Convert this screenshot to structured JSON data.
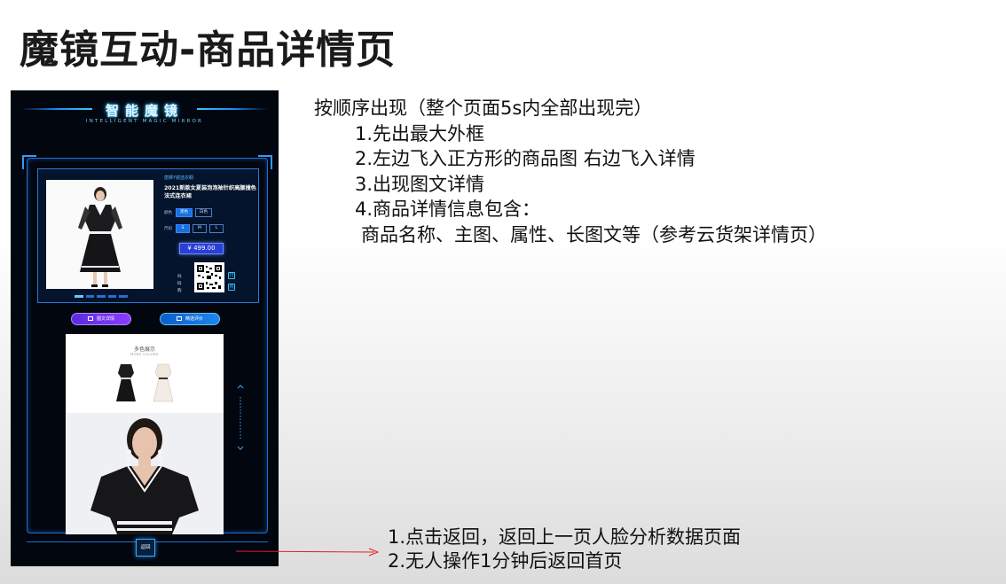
{
  "slide": {
    "title": "魔镜互动-商品详情页"
  },
  "mirror": {
    "brand": "智能魔镜",
    "brand_sub": "INTELLIGENT MAGIC MIRROR",
    "product": {
      "shop": "唐狮Y镜选衣橱",
      "name": "2021新款女夏装泡泡袖针织高腰撞色法式连衣裙",
      "color_label": "颜色",
      "colors": [
        "黑色",
        "白色"
      ],
      "size_label": "尺码",
      "sizes": [
        "S",
        "M",
        "L"
      ],
      "price": "¥ 499.00",
      "qr_side_text": [
        "扫",
        "码",
        "购"
      ],
      "qr_icon_1": "扫",
      "qr_icon_2": "购"
    },
    "tabs": {
      "detail": "图文详情",
      "review": "精选评价"
    },
    "detail": {
      "colors_title": "多色展示",
      "colors_sub": "MORE COLORS"
    },
    "back_label": "返回"
  },
  "notes": {
    "heading": "按顺序出现（整个页面5s内全部出现完）",
    "steps": [
      "1.先出最大外框",
      "2.左边飞入正方形的商品图  右边飞入详情",
      "3.出现图文详情",
      "4.商品详情信息包含："
    ],
    "detail_line": "商品名称、主图、属性、长图文等（参考云货架详情页）"
  },
  "back_notes": [
    "1.点击返回，返回上一页人脸分析数据页面",
    "2.无人操作1分钟后返回首页"
  ],
  "colors": {
    "accent_blue": "#1f6fd1",
    "price_blue": "#2a3fd6",
    "tab_purple": "#7a35f0",
    "arrow_red": "#e02020"
  }
}
